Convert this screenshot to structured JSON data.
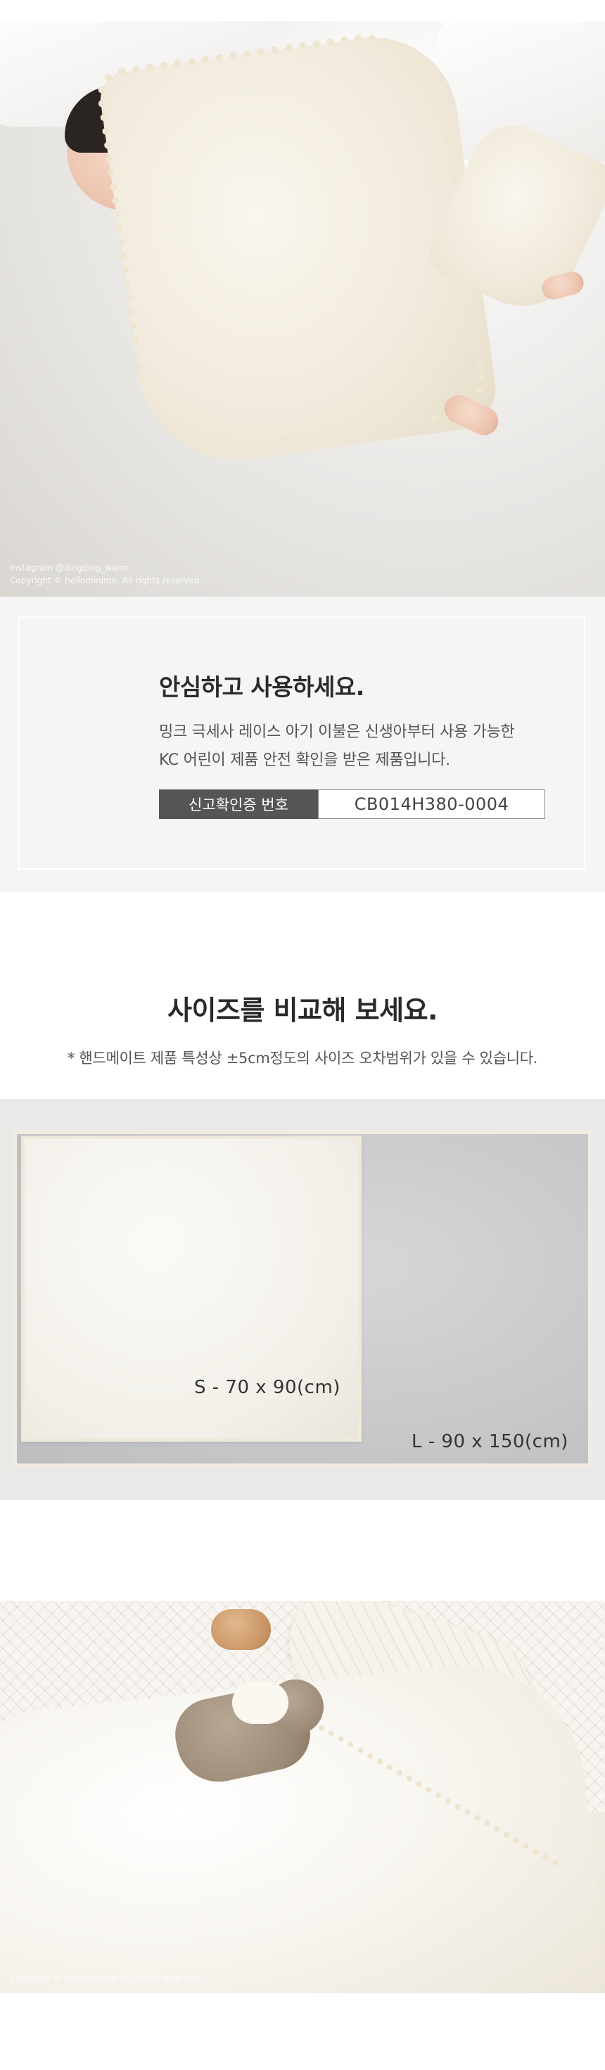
{
  "hero": {
    "credit_line1": "Instagram @dingding_warm",
    "credit_line2": "Copyright © hellominime. All rights reserved."
  },
  "notice": {
    "title": "안심하고 사용하세요.",
    "desc_line1": "밍크 극세사 레이스 아기 이불은 신생아부터 사용 가능한",
    "desc_line2": "KC 어린이 제품 안전 확인을 받은 제품입니다.",
    "cert_label": "신고확인증 번호",
    "cert_value": "CB014H380-0004"
  },
  "size_section": {
    "title": "사이즈를 비교해 보세요.",
    "note": "* 핸드메이트 제품 특성상 ±5cm정도의 사이즈 오차범위가 있을 수 있습니다.",
    "small_label": "S - 70 x 90(cm)",
    "large_label": "L - 90 x 150(cm)"
  },
  "lifestyle": {
    "credit": "Copyright © hellominime. All rights reserved."
  },
  "colors": {
    "band": "#f5f5f5",
    "label_bg": "#555555",
    "blanket_gray": "#c8c7c9",
    "blanket_ivory": "#f2efe8"
  }
}
